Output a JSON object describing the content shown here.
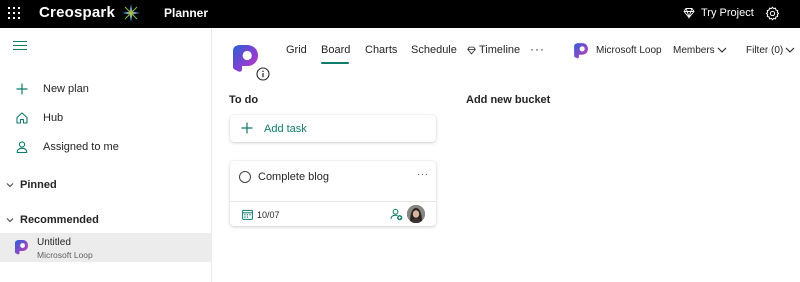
{
  "topbar": {
    "brand": "Creospark",
    "app_name": "Planner",
    "try_project_label": "Try Project"
  },
  "sidebar": {
    "items": [
      {
        "label": "New plan",
        "icon": "plus-icon"
      },
      {
        "label": "Hub",
        "icon": "home-icon"
      },
      {
        "label": "Assigned to me",
        "icon": "person-icon"
      }
    ],
    "sections": {
      "pinned": "Pinned",
      "recommended": "Recommended"
    },
    "recommended_plans": [
      {
        "title": "Untitled",
        "subtitle": "Microsoft Loop",
        "icon": "loop-logo"
      }
    ]
  },
  "header": {
    "tabs": [
      {
        "label": "Grid"
      },
      {
        "label": "Board",
        "active": true
      },
      {
        "label": "Charts"
      },
      {
        "label": "Schedule"
      },
      {
        "label": "Timeline",
        "icon": "diamond-icon"
      }
    ],
    "more_label": "···",
    "loop_label": "Microsoft Loop",
    "members_label": "Members",
    "filter_label": "Filter (0)"
  },
  "board": {
    "buckets": [
      {
        "title": "To do",
        "add_task_label": "Add task",
        "tasks": [
          {
            "title": "Complete blog",
            "due": "10/07",
            "more": "···"
          }
        ]
      }
    ],
    "add_bucket_label": "Add new bucket"
  },
  "colors": {
    "accent": "#0f7b6c",
    "topbar_bg": "#000000",
    "selected_row_bg": "#ececec",
    "loop_gradient_start": "#2c5fd6",
    "loop_gradient_end": "#d439b8"
  }
}
